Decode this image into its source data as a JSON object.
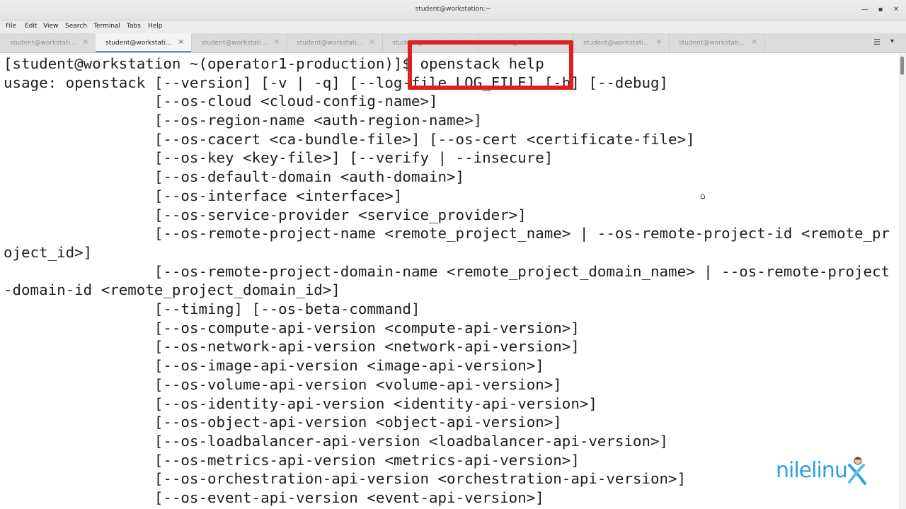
{
  "window": {
    "title": "student@workstation:~",
    "minimize_icon": "minimize-icon",
    "maximize_icon": "maximize-icon",
    "close_icon": "close-icon"
  },
  "menu": [
    "File",
    "Edit",
    "View",
    "Search",
    "Terminal",
    "Tabs",
    "Help"
  ],
  "tabs": [
    {
      "label": "student@workstati...",
      "active": false
    },
    {
      "label": "student@workstati...",
      "active": true
    },
    {
      "label": "student@workstati...",
      "active": false
    },
    {
      "label": "student@workstati...",
      "active": false
    },
    {
      "label": "student@workstati...",
      "active": false
    },
    {
      "label": "student@workstati...",
      "active": false
    },
    {
      "label": "student@workstati...",
      "active": false
    },
    {
      "label": "student@workstati...",
      "active": false
    }
  ],
  "tab_close_symbol": "×",
  "tab_menu_symbol": "☰",
  "tab_caret_symbol": "▾",
  "terminal": {
    "lines": [
      "[student@workstation ~(operator1-production)]$ openstack help",
      "usage: openstack [--version] [-v | -q] [--log-file LOG_FILE] [-h] [--debug]",
      "                 [--os-cloud <cloud-config-name>]",
      "                 [--os-region-name <auth-region-name>]",
      "                 [--os-cacert <ca-bundle-file>] [--os-cert <certificate-file>]",
      "                 [--os-key <key-file>] [--verify | --insecure]",
      "                 [--os-default-domain <auth-domain>]",
      "                 [--os-interface <interface>]",
      "                 [--os-service-provider <service_provider>]",
      "                 [--os-remote-project-name <remote_project_name> | --os-remote-project-id <remote_pr",
      "oject_id>]",
      "                 [--os-remote-project-domain-name <remote_project_domain_name> | --os-remote-project",
      "-domain-id <remote_project_domain_id>]",
      "                 [--timing] [--os-beta-command]",
      "                 [--os-compute-api-version <compute-api-version>]",
      "                 [--os-network-api-version <network-api-version>]",
      "                 [--os-image-api-version <image-api-version>]",
      "                 [--os-volume-api-version <volume-api-version>]",
      "                 [--os-identity-api-version <identity-api-version>]",
      "                 [--os-object-api-version <object-api-version>]",
      "                 [--os-loadbalancer-api-version <loadbalancer-api-version>]",
      "                 [--os-metrics-api-version <metrics-api-version>]",
      "                 [--os-orchestration-api-version <orchestration-api-version>]",
      "                 [--os-event-api-version <event-api-version>]"
    ]
  },
  "annotation_color": "#e02020",
  "watermark": {
    "text": "nilelinu",
    "suffix": "x"
  },
  "colors": {
    "accent": "#4a90d9",
    "logo": "#2f9fe0"
  }
}
